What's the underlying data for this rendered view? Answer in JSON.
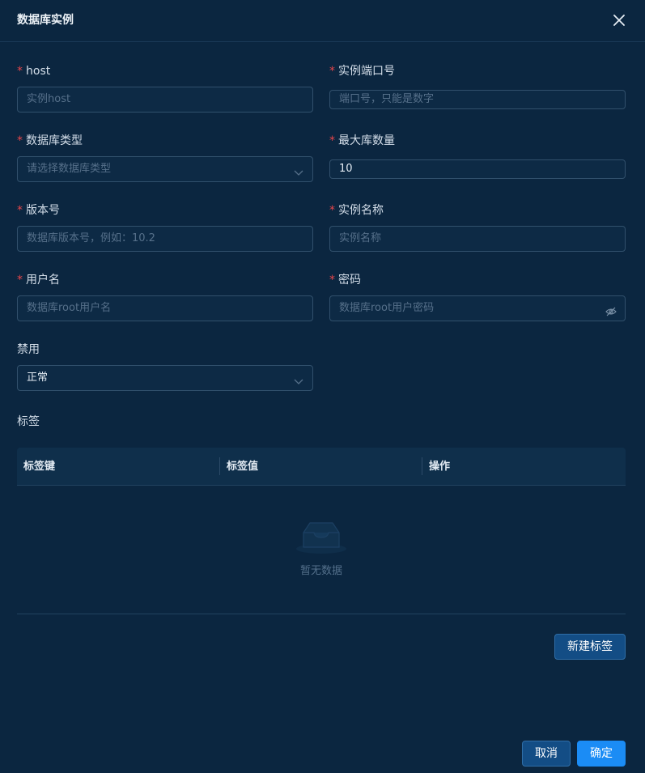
{
  "dialog": {
    "title": "数据库实例"
  },
  "form": {
    "host": {
      "label": "host",
      "required": true,
      "placeholder": "实例host",
      "value": ""
    },
    "port": {
      "label": "实例端口号",
      "required": true,
      "placeholder": "端口号，只能是数字",
      "value": ""
    },
    "db_type": {
      "label": "数据库类型",
      "required": true,
      "placeholder": "请选择数据库类型",
      "value": ""
    },
    "max_db": {
      "label": "最大库数量",
      "required": true,
      "placeholder": "",
      "value": "10"
    },
    "version": {
      "label": "版本号",
      "required": true,
      "placeholder": "数据库版本号，例如：10.2",
      "value": ""
    },
    "instance_name": {
      "label": "实例名称",
      "required": true,
      "placeholder": "实例名称",
      "value": ""
    },
    "username": {
      "label": "用户名",
      "required": true,
      "placeholder": "数据库root用户名",
      "value": ""
    },
    "password": {
      "label": "密码",
      "required": true,
      "placeholder": "数据库root用户密码",
      "value": ""
    },
    "disabled": {
      "label": "禁用",
      "required": false,
      "value": "正常"
    },
    "required_mark": "*"
  },
  "tags": {
    "label": "标签",
    "columns": [
      "标签键",
      "标签值",
      "操作"
    ],
    "empty_text": "暂无数据",
    "add_button": "新建标签"
  },
  "footer": {
    "cancel": "取消",
    "confirm": "确定"
  },
  "colors": {
    "background": "#0b2640",
    "primary": "#1b8cf5",
    "required": "#e8464b"
  },
  "icons": {
    "close": "close-icon",
    "select_arrow": "chevron-down-icon",
    "password_toggle": "eye-off-icon",
    "empty": "inbox-icon"
  }
}
